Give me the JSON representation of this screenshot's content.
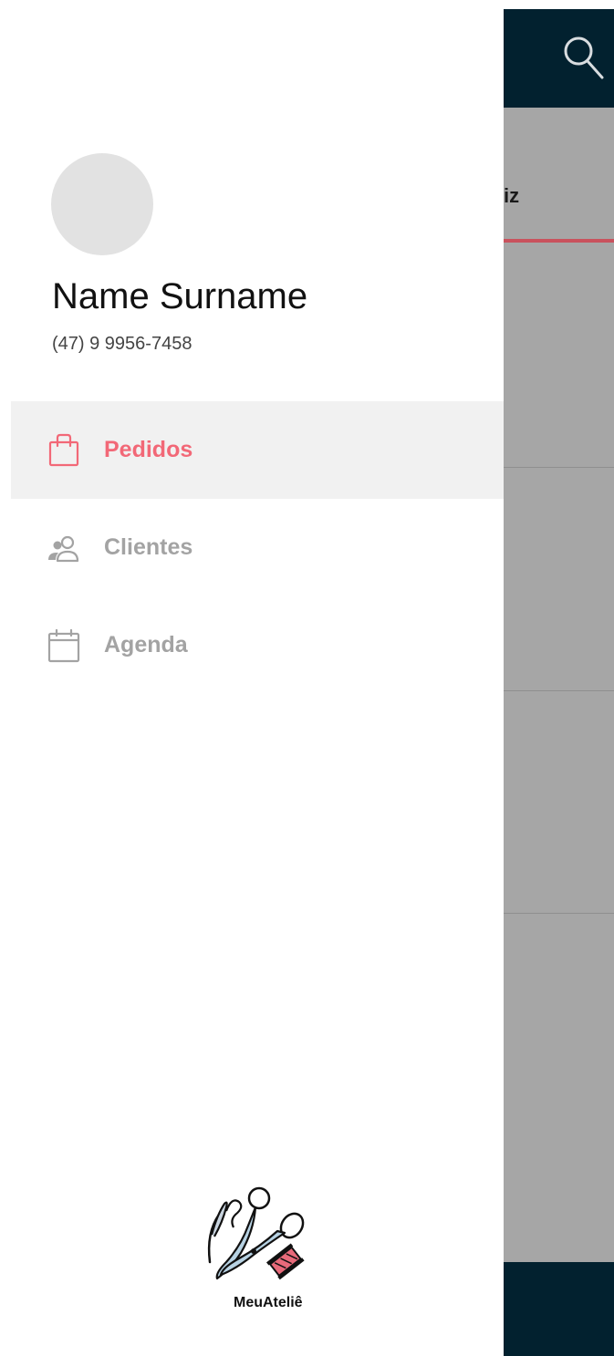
{
  "app": {
    "tab_label": "iz",
    "colors": {
      "topbar": "#02212f",
      "overlay": "#a6a6a6",
      "tab_indicator": "#c9525d"
    }
  },
  "drawer": {
    "user": {
      "name": "Name Surname",
      "phone": "(47) 9 9956-7458"
    },
    "nav": [
      {
        "label": "Pedidos",
        "icon": "shopping-bag-icon",
        "active": true
      },
      {
        "label": "Clientes",
        "icon": "users-icon",
        "active": false
      },
      {
        "label": "Agenda",
        "icon": "calendar-icon",
        "active": false
      }
    ],
    "brand": {
      "name": "MeuAteliê",
      "logo_icon": "sewing-tools-logo"
    },
    "colors": {
      "active_text": "#f26877",
      "inactive_text": "#a3a3a3",
      "active_bg": "#f1f1f1"
    }
  },
  "icons": {
    "search": "search-icon"
  }
}
